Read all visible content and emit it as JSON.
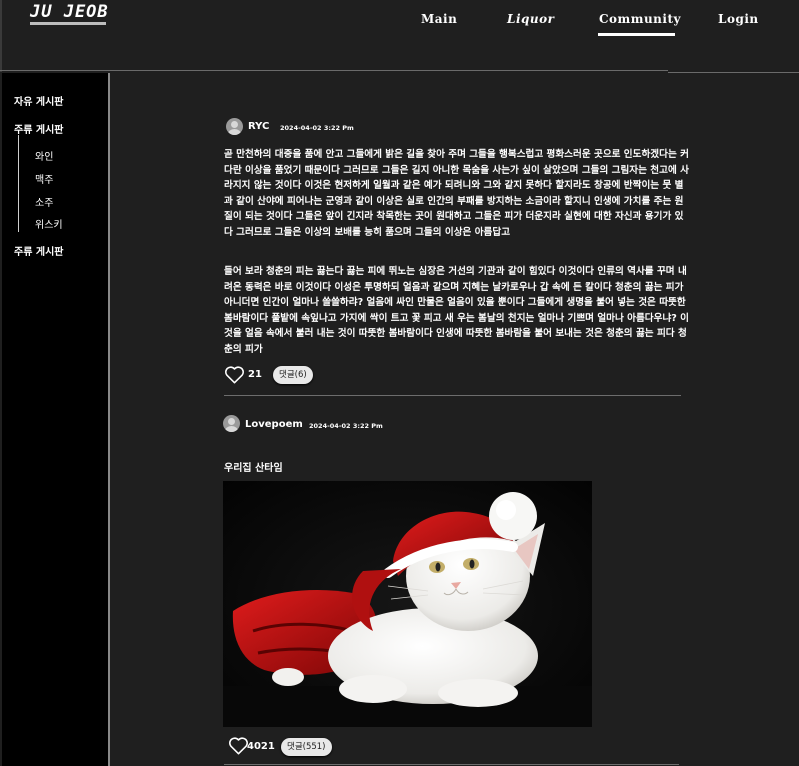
{
  "app": {
    "logo": "JU JEOB",
    "nav": [
      {
        "label": "Main"
      },
      {
        "label": "Liquor"
      },
      {
        "label": "Community",
        "active": true
      },
      {
        "label": "Login"
      }
    ]
  },
  "sidebar": {
    "free_board": "자유 게시판",
    "liquor_board": "주류 게시판",
    "liquor_subs": [
      "와인",
      "맥주",
      "소주",
      "위스키"
    ],
    "liquor_board_2": "주류 게시판"
  },
  "posts": [
    {
      "author": "RYC",
      "date": "2024-04-02 3:22 Pm",
      "paragraphs": [
        "곧 만천하의 대중을 품에 안고 그들에게 밝은 길을 찾아 주며 그들을 행복스럽고 평화스러운 곳으로 인도하겠다는 커다란 이상을 품었기 때문이다 그러므로 그들은 길지 아니한 목숨을 사는가 싶이 살았으며 그들의 그림자는 천고에 사라지지 않는 것이다 이것은 현저하게 일월과 같은 예가 되려니와 그와 같지 못하다 할지라도 창공에 반짝이는 뭇 별과 같이 산야에 피어나는 군영과 같이 이상은 실로 인간의 부패를 방지하는 소금이라 할지니 인생에 가치를 주는 원질이 되는 것이다 그들은 앞이 긴지라 착목한는 곳이 원대하고 그들은 피가 더운지라 실현에 대한 자신과 용기가 있다 그러므로 그들은 이상의 보배를 능히 품으며 그들의 이상은 아름답고",
        "들어 보라 청춘의 피는 끓는다 끓는 피에 뛰노는 심장은 거선의 기관과 같이 힘있다 이것이다 인류의 역사를 꾸며 내려온 동력은 바로 이것이다 이성은 투명하되 얼음과 같으며 지혜는 날카로우나 갑 속에 든 칼이다 청춘의 끓는 피가 아니더면 인간이 얼마나 쓸쓸하랴? 얼음에 싸인 만물은 얼음이 있을 뿐이다 그들에게 생명을 불어 넣는 것은 따뜻한 봄바람이다 풀밭에 속잎나고 가지에 싹이 트고 꽃 피고 새 우는 봄날의 천지는 얼마나 기쁘며 얼마나 아름다우냐? 이것을 얼음 속에서 불러 내는 것이 따뜻한 봄바람이다 인생에 따뜻한 봄바람을 불어 보내는 것은 청춘의 끓는 피다 청춘의 피가"
      ],
      "likes": "21",
      "comments": "댓글(6)"
    },
    {
      "author": "Lovepoem",
      "date": "2024-04-02 3:22 Pm",
      "title": "우리집 산타임",
      "likes": "4021",
      "comments": "댓글(551)"
    }
  ],
  "icons": {
    "avatar": "user-avatar-icon",
    "like": "heart-outline-icon"
  },
  "colors": {
    "background": "#1f1f1f",
    "sidebar": "#000000",
    "text": "#ffffff",
    "comment_button": "#e9e9e9"
  }
}
